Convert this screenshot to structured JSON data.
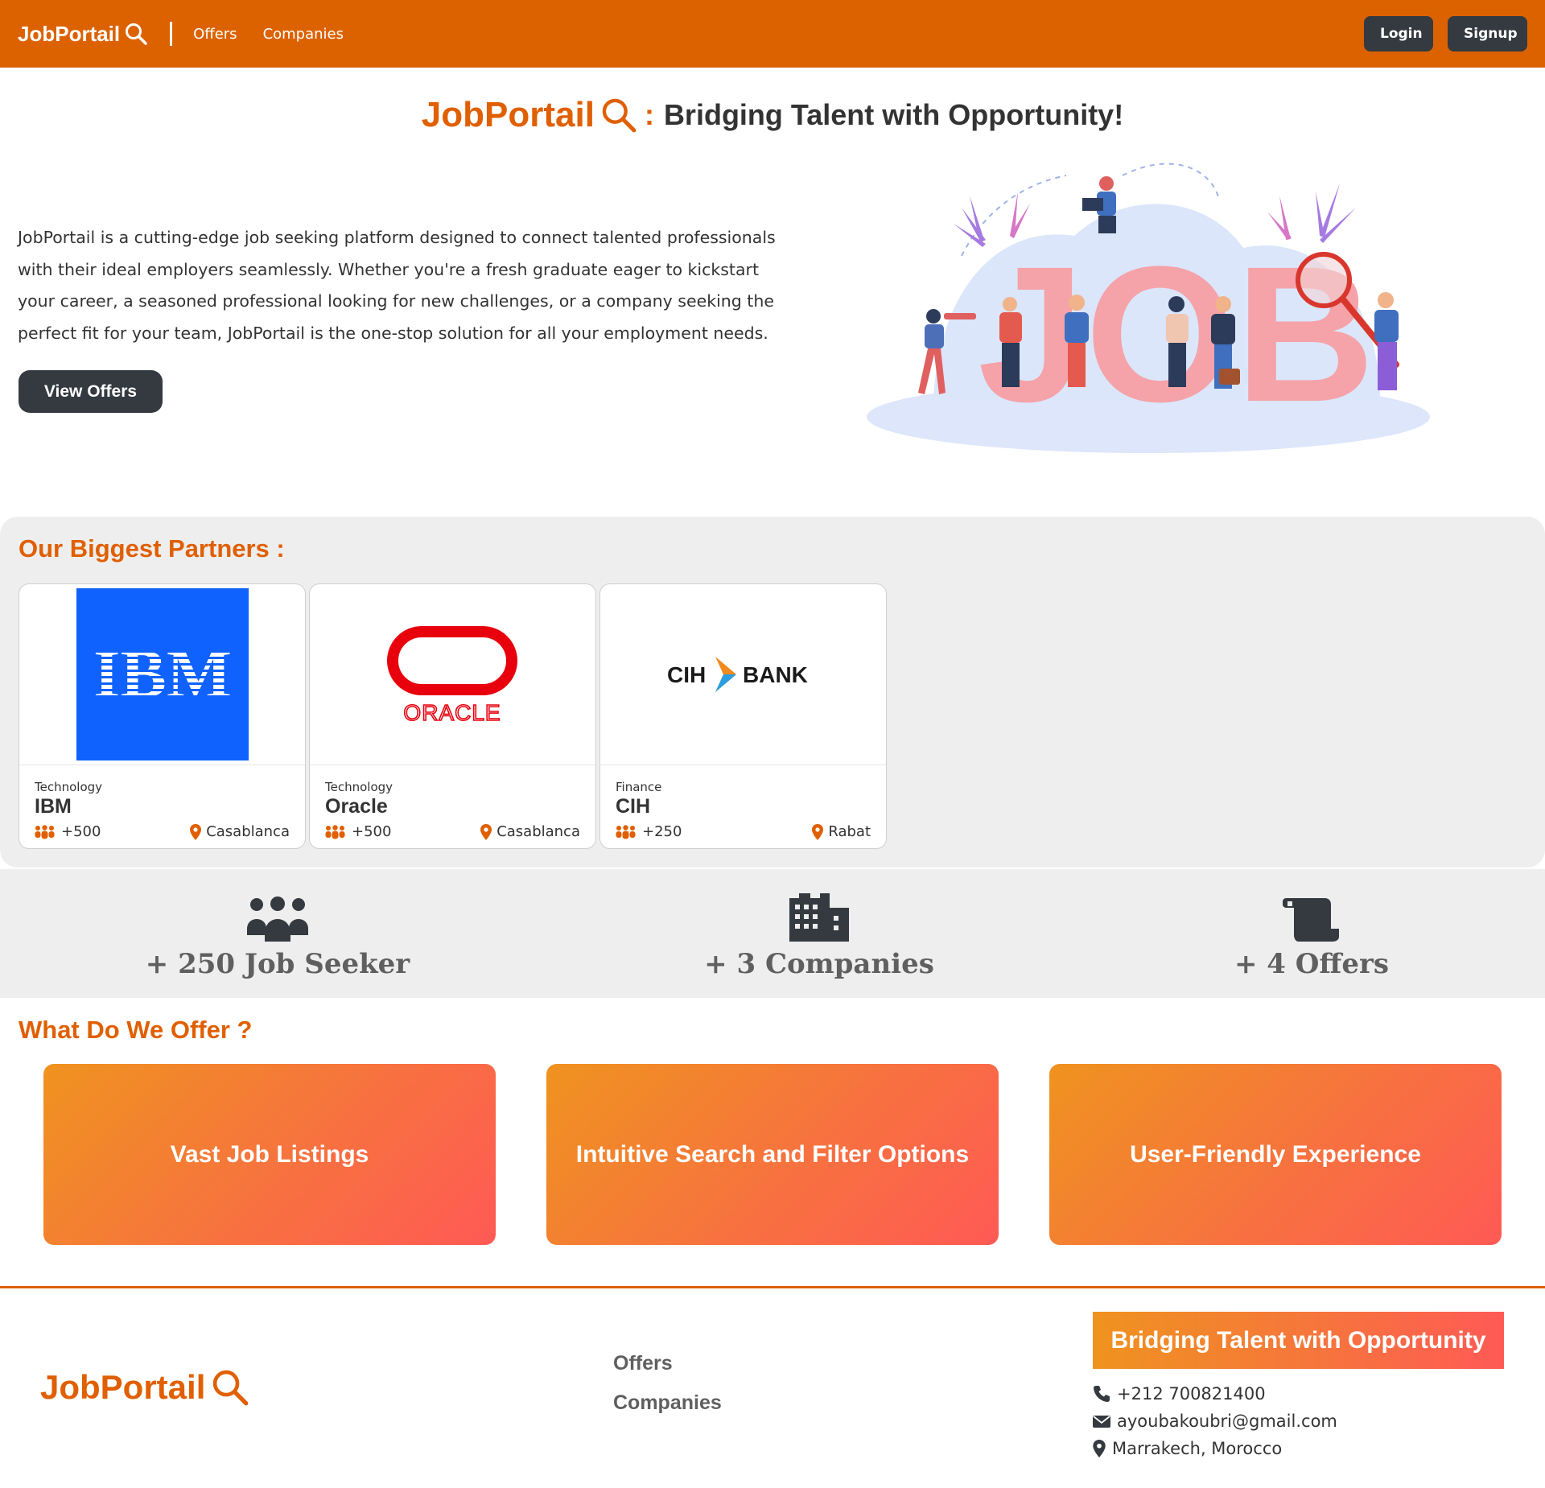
{
  "navbar": {
    "brand": "JobPortail",
    "links": [
      "Offers",
      "Companies"
    ],
    "login_label": "Login",
    "signup_label": "Signup"
  },
  "hero": {
    "brand": "JobPortail",
    "colon": ":",
    "tagline": "Bridging Talent with Opportunity!",
    "description": "JobPortail is a cutting-edge job seeking platform designed to connect talented professionals with their ideal employers seamlessly. Whether you're a fresh graduate eager to kickstart your career, a seasoned professional looking for new challenges, or a company seeking the perfect fit for your team, JobPortail is the one-stop solution for all your employment needs.",
    "cta_label": "View Offers",
    "illustration_text": "JOB"
  },
  "partners": {
    "title": "Our Biggest Partners :",
    "cards": [
      {
        "sector": "Technology",
        "name": "IBM",
        "employees": "+500",
        "location": "Casablanca",
        "logo_text": "IBM"
      },
      {
        "sector": "Technology",
        "name": "Oracle",
        "employees": "+500",
        "location": "Casablanca",
        "logo_text": "ORACLE"
      },
      {
        "sector": "Finance",
        "name": "CIH",
        "employees": "+250",
        "location": "Rabat",
        "logo_text": "CIH BANK"
      }
    ]
  },
  "stats": [
    {
      "label": "+ 250 Job Seeker",
      "icon": "people-group-icon"
    },
    {
      "label": "+ 3 Companies",
      "icon": "building-icon"
    },
    {
      "label": "+ 4 Offers",
      "icon": "scroll-icon"
    }
  ],
  "offer": {
    "title": "What Do We Offer ?",
    "items": [
      "Vast Job Listings",
      "Intuitive Search and Filter Options",
      "User-Friendly Experience"
    ]
  },
  "footer": {
    "brand": "JobPortail",
    "links": [
      "Offers",
      "Companies"
    ],
    "tagline": "Bridging Talent with Opportunity",
    "phone": "+212 700821400",
    "email": "ayoubakoubri@gmail.com",
    "address": "Marrakech, Morocco"
  },
  "colors": {
    "accent": "#dc6200",
    "dark_button": "#343a40",
    "gradient_start": "#ef931f",
    "gradient_end": "#ff5a55"
  }
}
